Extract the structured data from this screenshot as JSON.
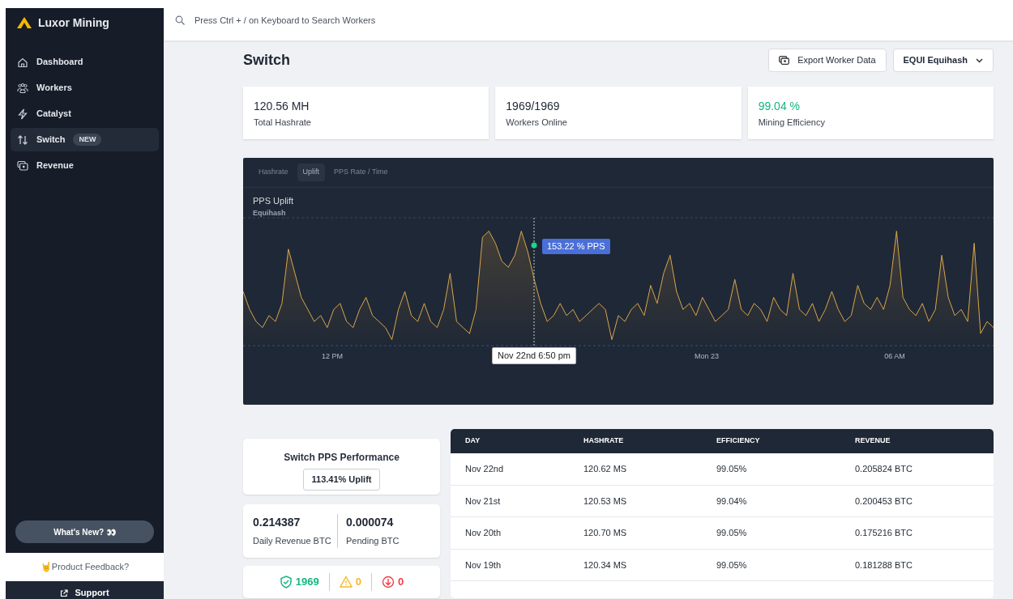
{
  "app": {
    "name": "Luxor Mining"
  },
  "sidebar": {
    "items": [
      {
        "label": "Dashboard",
        "selected": false
      },
      {
        "label": "Workers",
        "selected": false
      },
      {
        "label": "Catalyst",
        "selected": false
      },
      {
        "label": "Switch",
        "selected": true,
        "badge": "NEW"
      },
      {
        "label": "Revenue",
        "selected": false
      }
    ],
    "whats_new": "What's New? 👀",
    "feedback": "🤘Product Feedback?",
    "support": "Support"
  },
  "search": {
    "placeholder": "Press Ctrl + / on Keyboard to Search Workers"
  },
  "page": {
    "title": "Switch",
    "export_button": "Export Worker Data",
    "algorithm": "EQUI Equihash"
  },
  "stats": [
    {
      "value": "120.56 MH",
      "label": "Total Hashrate",
      "kind": "plain"
    },
    {
      "value": "1969/1969",
      "label": "Workers Online",
      "kind": "plain"
    },
    {
      "value": "99.04 %",
      "label": "Mining Efficiency",
      "kind": "positive"
    }
  ],
  "chart": {
    "tabs": [
      {
        "label": "Hashrate",
        "selected": false
      },
      {
        "label": "Uplift",
        "selected": true
      },
      {
        "label": "PPS Rate / Time",
        "selected": false
      }
    ],
    "title": "PPS Uplift",
    "subtitle": "Equihash",
    "tooltip": "153.22 % PPS",
    "cursor_label": "Nov 22nd 6:50 pm",
    "x_labels": [
      "12 PM",
      "Mon 23",
      "06 AM"
    ]
  },
  "performance": {
    "title": "Switch PPS Performance",
    "uplift": "113.41% Uplift"
  },
  "revenue": [
    {
      "value": "0.214387",
      "label": "Daily Revenue BTC"
    },
    {
      "value": "0.000074",
      "label": "Pending BTC"
    }
  ],
  "status": [
    {
      "kind": "ok",
      "count": "1969"
    },
    {
      "kind": "warning",
      "count": "0"
    },
    {
      "kind": "down",
      "count": "0"
    }
  ],
  "table": {
    "columns": [
      "DAY",
      "HASHRATE",
      "EFFICIENCY",
      "REVENUE"
    ],
    "rows": [
      [
        "Nov 22nd",
        "120.62 MS",
        "99.05%",
        "0.205824 BTC"
      ],
      [
        "Nov 21st",
        "120.53 MS",
        "99.04%",
        "0.200453 BTC"
      ],
      [
        "Nov 20th",
        "120.70 MS",
        "99.05%",
        "0.175216 BTC"
      ],
      [
        "Nov 19th",
        "120.34 MS",
        "99.05%",
        "0.181288 BTC"
      ]
    ]
  }
}
